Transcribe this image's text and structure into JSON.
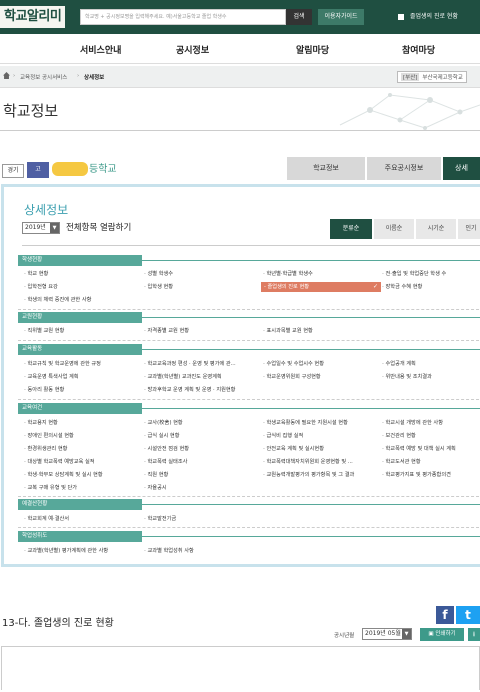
{
  "header": {
    "logo": "학교알리미",
    "search_placeholder": "학교명 + 공시정보명을 입력해주세요. 예)서울고등학교 졸업 학생수",
    "search_button": "검색",
    "guide_button": "이용자가이드",
    "grad_link": "졸업생의 진로 현황"
  },
  "nav": [
    "서비스안내",
    "공시정보",
    "알림마당",
    "참여마당"
  ],
  "breadcrumb": {
    "items": [
      "교육정보 공시서비스",
      "상세정보"
    ],
    "school_tag": "[부산]",
    "school_name": "부산국제고등학교"
  },
  "page_title": "학교정보",
  "school_bar": {
    "region": "경기",
    "level": "고",
    "name_suffix": "등학교",
    "tabs": [
      "학교정보",
      "주요공시정보",
      "상세"
    ],
    "active_tab": 2
  },
  "detail": {
    "title": "상세정보",
    "year": "2019년",
    "view_all": "전체항목 열람하기",
    "sort_buttons": [
      "분류순",
      "이름순",
      "시기순",
      "인기"
    ],
    "categories": [
      {
        "label": "학생현황",
        "items": [
          "학교 현황",
          "성별 학생수",
          "학년별·학급별 학생수",
          "전·출입 및 학업중단 학생 수",
          "입학전형 요강",
          "입학생 현황",
          "졸업생의 진로 현황",
          "장학금 수혜 현황",
          "학생의 체력 증진에 관한 사항"
        ]
      },
      {
        "label": "교원현황",
        "items": [
          "직위별 교원 현황",
          "자격종별 교원 현황",
          "표시과목별 교원 현황"
        ]
      },
      {
        "label": "교육활동",
        "items": [
          "학교규칙 및 학교운영에 관한 규정",
          "학교교육과정 편성 · 운영 및 평가에 관...",
          "수업일수 및 수업시수 현황",
          "수업공개 계획",
          "교육운영 특색사업 계획",
          "교과별(학년별) 교과진도 운영계획",
          "학교운영위원회 구성현황",
          "위반내용 및 조치결과",
          "동아리 활동 현황",
          "방과후학교 운영 계획 및 운영 · 지원현황"
        ]
      },
      {
        "label": "교육여건",
        "items": [
          "학교용지 현황",
          "교사(校舍) 현황",
          "학생교육활동에 필요한 지원시설 현황",
          "학교시설 개방에 관한 사항",
          "장애인 편의시설 현황",
          "급식 실시 현황",
          "급식비 집행 실적",
          "보건관리 현황",
          "환경위생관리 현황",
          "시설안전 점검 현황",
          "안전교육 계획 및 실시현황",
          "학교폭력 예방 및 대책 실시 계획",
          "대상별 학교폭력 예방교육 실적",
          "학교폭력 실태조사",
          "학교폭력대책자치위원회 운영현황 및 ...",
          "학교도서관 현황",
          "학생·학부모 상담계획 및 실시 현황",
          "직원 현황",
          "교원능력개발평가의 평가항목 및 그 결과",
          "학교평가지표 및 평가종합의견",
          "교복 구매 유형 및 단가",
          "자율공시"
        ]
      },
      {
        "label": "예결산현황",
        "items": [
          "학교회계 예·결산서",
          "학교발전기금"
        ]
      },
      {
        "label": "학업성취도",
        "items": [
          "교과별(학년별) 평가계획에 관한 사항",
          "교과별 학업성취 사항"
        ]
      }
    ]
  },
  "section": {
    "heading": "13-다. 졸업생의 진로 현황",
    "notice_label": "공시년월",
    "notice_value": "2019년 05월",
    "print_button": "인쇄하기",
    "download_icon": "download-icon"
  },
  "colors": {
    "dark_green": "#1f4f41",
    "teal": "#57a89a",
    "highlight": "#de7c62",
    "panel_border": "#c8e2ec"
  }
}
